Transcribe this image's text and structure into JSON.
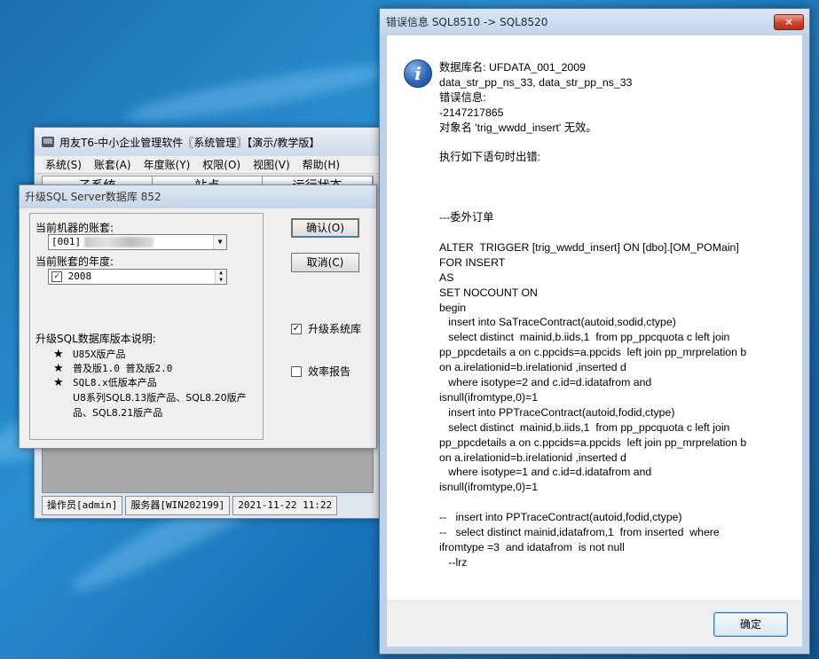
{
  "app": {
    "title": "用友T6-中小企业管理软件〖系统管理〗【演示/教学版】",
    "menu": [
      "系统(S)",
      "账套(A)",
      "年度账(Y)",
      "权限(O)",
      "视图(V)",
      "帮助(H)"
    ],
    "table_headers": [
      "子系统",
      "站点",
      "运行状态"
    ],
    "status": {
      "operator": "操作员[admin]",
      "server": "服务器[WIN202199]",
      "datetime": "2021-11-22 11:22"
    }
  },
  "upgrade_dialog": {
    "title": "升级SQL Server数据库 852",
    "account_label": "当前机器的账套:",
    "account_value": "[001]",
    "year_label": "当前账套的年度:",
    "year_value": "2008",
    "ok_label": "确认(O)",
    "cancel_label": "取消(C)",
    "upgrade_system_label": "升级系统库",
    "upgrade_system_checked": true,
    "efficiency_report_label": "效率报告",
    "efficiency_report_checked": false,
    "notes_title": "升级SQL数据库版本说明:",
    "notes": [
      "U85X版产品",
      "普及版1.0 普及版2.0",
      "SQL8.x低版本产品"
    ],
    "notes_detail": "U8系列SQL8.13版产品、SQL8.20版产品、SQL8.21版产品"
  },
  "error_dialog": {
    "title": "错误信息  SQL8510 -> SQL8520",
    "close_label": "✕",
    "ok_label": "确定",
    "message": "数据库名: UFDATA_001_2009\ndata_str_pp_ns_33, data_str_pp_ns_33\n错误信息:\n-2147217865\n对象名 'trig_wwdd_insert' 无效。\n\n执行如下语句时出错:\n\n\n\n---委外订单\n\nALTER  TRIGGER [trig_wwdd_insert] ON [dbo].[OM_POMain]\nFOR INSERT\nAS\nSET NOCOUNT ON\nbegin\n   insert into SaTraceContract(autoid,sodid,ctype)\n   select distinct  mainid,b.iids,1  from pp_ppcquota c left join\npp_ppcdetails a on c.ppcids=a.ppcids  left join pp_mrprelation b\non a.irelationid=b.irelationid ,inserted d\n   where isotype=2 and c.id=d.idatafrom and\nisnull(ifromtype,0)=1\n   insert into PPTraceContract(autoid,fodid,ctype)\n   select distinct  mainid,b.iids,1  from pp_ppcquota c left join\npp_ppcdetails a on c.ppcids=a.ppcids  left join pp_mrprelation b\non a.irelationid=b.irelationid ,inserted d\n   where isotype=1 and c.id=d.idatafrom and\nisnull(ifromtype,0)=1\n\n--   insert into PPTraceContract(autoid,fodid,ctype)\n--   select distinct mainid,idatafrom,1  from inserted  where\nifromtype =3  and idatafrom  is not null\n   --lrz"
  }
}
